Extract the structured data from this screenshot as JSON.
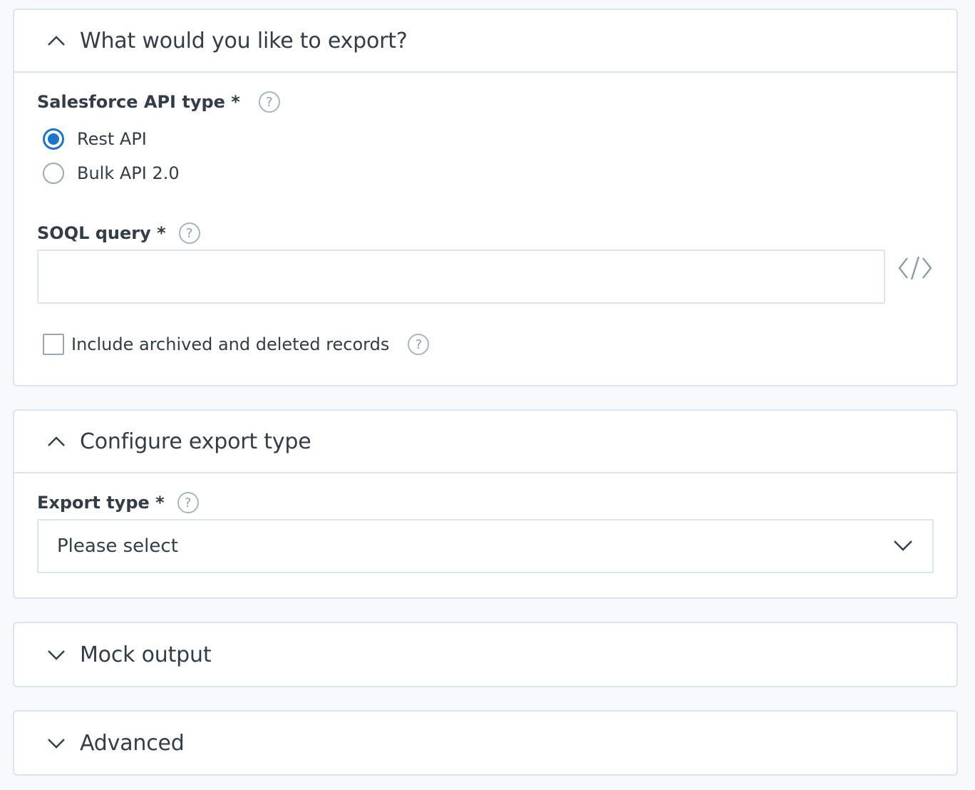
{
  "sections": {
    "export": {
      "title": "What would you like to export?",
      "api_type": {
        "label": "Salesforce API type *",
        "options": [
          "Rest API",
          "Bulk API 2.0"
        ],
        "selected": "Rest API"
      },
      "soql": {
        "label": "SOQL query *",
        "value": "",
        "placeholder": ""
      },
      "include_archived": {
        "label": "Include archived and deleted records",
        "checked": false
      }
    },
    "export_type": {
      "title": "Configure export type",
      "field": {
        "label": "Export type *",
        "selected": "Please select"
      }
    },
    "mock_output": {
      "title": "Mock output"
    },
    "advanced": {
      "title": "Advanced"
    }
  },
  "icons": {
    "help": "?",
    "expanded": "chevron-up-icon",
    "collapsed": "chevron-down-icon",
    "code": "code-icon",
    "dropdown": "chevron-down-icon"
  },
  "colors": {
    "accent": "#1d74c8",
    "border": "#dde4ec",
    "text": "#333d47",
    "muted": "#8f9dab",
    "background": "#f7f9fc"
  }
}
